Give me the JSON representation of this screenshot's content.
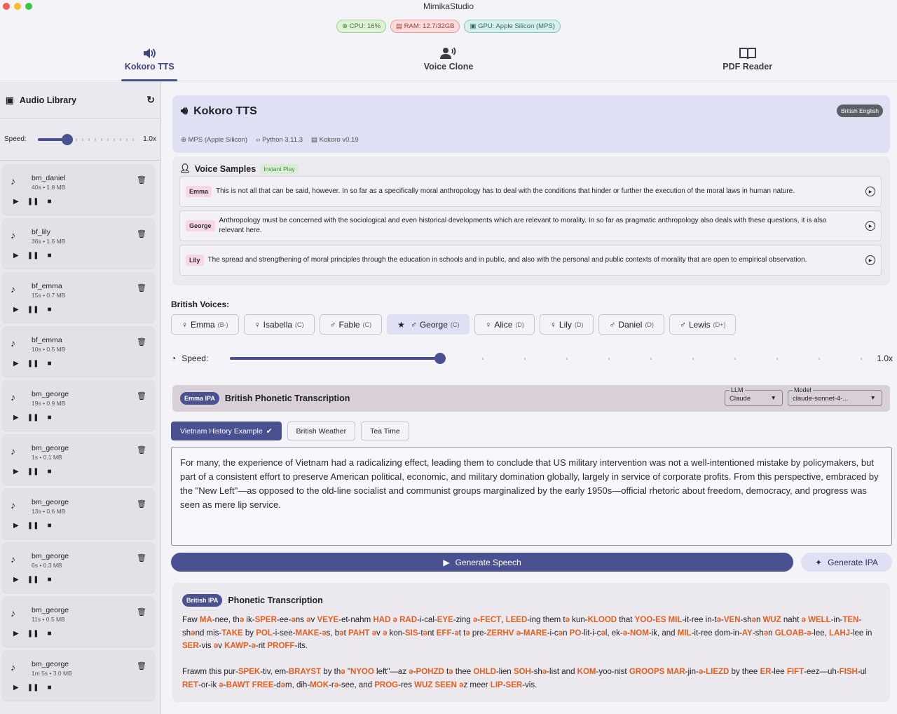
{
  "window": {
    "title": "MimikaStudio"
  },
  "stats": {
    "cpu": "CPU: 16%",
    "ram": "RAM: 12.7/32GB",
    "gpu": "GPU: Apple Silicon (MPS)"
  },
  "tabs": [
    {
      "label": "Kokoro TTS"
    },
    {
      "label": "Voice Clone"
    },
    {
      "label": "PDF Reader"
    }
  ],
  "library": {
    "title": "Audio Library",
    "speed_label": "Speed:",
    "speed_value": "1.0x",
    "items": [
      {
        "name": "bm_daniel",
        "meta": "40s • 1.8 MB"
      },
      {
        "name": "bf_lily",
        "meta": "36s • 1.6 MB"
      },
      {
        "name": "bf_emma",
        "meta": "15s • 0.7 MB"
      },
      {
        "name": "bf_emma",
        "meta": "10s • 0.5 MB"
      },
      {
        "name": "bm_george",
        "meta": "19s • 0.9 MB"
      },
      {
        "name": "bm_george",
        "meta": "1s • 0.1 MB"
      },
      {
        "name": "bm_george",
        "meta": "13s • 0.6 MB"
      },
      {
        "name": "bm_george",
        "meta": "6s • 0.3 MB"
      },
      {
        "name": "bm_george",
        "meta": "11s • 0.5 MB"
      },
      {
        "name": "bm_george",
        "meta": "1m 5s • 3.0 MB"
      }
    ]
  },
  "header": {
    "title": "Kokoro TTS",
    "device": "MPS (Apple Silicon)",
    "python": "Python 3.11.3",
    "version": "Kokoro v0.19",
    "badge": "British English"
  },
  "samples": {
    "title": "Voice Samples",
    "tag": "Instant Play",
    "rows": [
      {
        "speaker": "Emma",
        "text": "This is not all that can be said, however. In so far as a specifically moral anthropology has to deal with the conditions that hinder or further the execution of the moral laws in human nature."
      },
      {
        "speaker": "George",
        "text": "Anthropology must be concerned with the sociological and even historical developments which are relevant to morality. In so far as pragmatic anthropology also deals with these questions, it is also relevant here."
      },
      {
        "speaker": "Lily",
        "text": "The spread and strengthening of moral principles through the education in schools and in public, and also with the personal and public contexts of morality that are open to empirical observation."
      }
    ]
  },
  "voices": {
    "label": "British Voices:",
    "items": [
      {
        "name": "Emma",
        "grade": "(B-)",
        "sym": "♀"
      },
      {
        "name": "Isabella",
        "grade": "(C)",
        "sym": "♀"
      },
      {
        "name": "Fable",
        "grade": "(C)",
        "sym": "♂"
      },
      {
        "name": "George",
        "grade": "(C)",
        "sym": "♂"
      },
      {
        "name": "Alice",
        "grade": "(D)",
        "sym": "♀"
      },
      {
        "name": "Lily",
        "grade": "(D)",
        "sym": "♀"
      },
      {
        "name": "Daniel",
        "grade": "(D)",
        "sym": "♂"
      },
      {
        "name": "Lewis",
        "grade": "(D+)",
        "sym": "♂"
      }
    ],
    "selected": "George"
  },
  "speed": {
    "label": "Speed:",
    "value": "1.0x"
  },
  "ipa": {
    "pill": "Emma IPA",
    "title": "British Phonetic Transcription",
    "llm_label": "LLM",
    "llm_value": "Claude",
    "model_label": "Model",
    "model_value": "claude-sonnet-4-..."
  },
  "examples": [
    {
      "label": "Vietnam History Example"
    },
    {
      "label": "British Weather"
    },
    {
      "label": "Tea Time"
    }
  ],
  "input_text": "For many, the experience of Vietnam had a radicalizing effect, leading them to conclude that US military intervention was not a well-intentioned mistake by policymakers, but part of a consistent effort to preserve American political, economic, and military domination globally, largely in service of corporate profits. From this perspective, embraced by the \"New Left\"—as opposed to the old-line socialist and communist groups marginalized by the early 1950s—official rhetoric about freedom, democracy, and progress was seen as mere lip service.",
  "buttons": {
    "generate": "Generate Speech",
    "generate_ipa": "Generate IPA"
  },
  "phonetic": {
    "pill": "British IPA",
    "title": "Phonetic Transcription",
    "para1": "Faw MA-nee, thə ik-SPER-ee-əns əv VEYE-et-nahm HAD ə RAD-i-cal-EYE-zing ə-FECT, LEED-ing them tə kun-KLOOD that YOO-ES MIL-it-ree in-tə-VEN-shən WUZ naht ə WELL-in-TEN-shənd mis-TAKE by POL-i-see-MAKE-əs, bət PAHT əv ə kon-SIS-tənt EFF-ət tə pre-ZERHV ə-MARE-i-cən PO-lit-i-cəl, ek-ə-NOM-ik, and MIL-it-ree dom-in-AY-shən GLOAB-ə-lee, LAHJ-lee in SER-vis əv KAWP-ə-rit PROFF-its.",
    "para2": "Frawm this pur-SPEK-tiv, em-BRAYST by thə \"NYOO left\"—az ə-POHZD tə thee OHLD-lien SOH-shə-list and KOM-yoo-nist GROOPS MAR-jin-ə-LIEZD by thee ER-lee FIFT-eez—uh-FISH-ul RET-or-ik ə-BAWT FREE-dəm, dih-MOK-rə-see, and PROG-res WUZ SEEN əz meer LIP-SER-vis."
  }
}
